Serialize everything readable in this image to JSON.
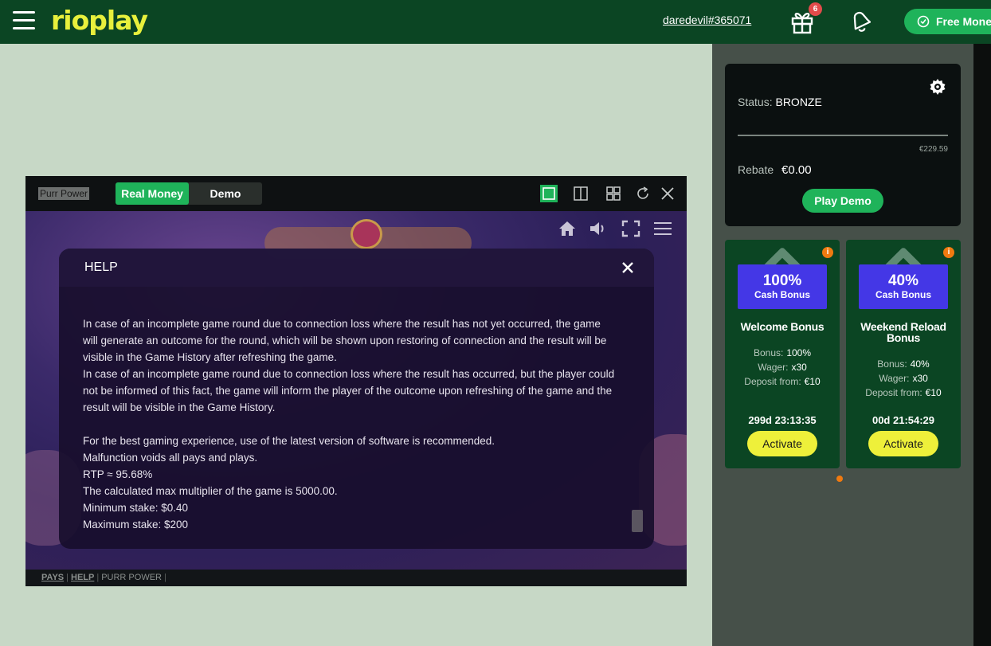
{
  "header": {
    "logo": "rioplay",
    "username": "daredevil#365071",
    "gift_count": "6",
    "free_money_label": "Free Mone"
  },
  "status_card": {
    "status_label": "Status:",
    "status_value": "BRONZE",
    "progress_value": "€229.59",
    "progress_fraction": 0.0,
    "rebate_label": "Rebate",
    "rebate_value": "€0.00",
    "play_demo_label": "Play Demo"
  },
  "bonuses": [
    {
      "percent": "100%",
      "type": "Cash Bonus",
      "name": "Welcome Bonus",
      "bonus_label": "Bonus:",
      "bonus_value": "100%",
      "wager_label": "Wager:",
      "wager_value": "x30",
      "deposit_label": "Deposit from:",
      "deposit_value": "€10",
      "timer": "299d  23:13:35",
      "activate_label": "Activate"
    },
    {
      "percent": "40%",
      "type": "Cash Bonus",
      "name": "Weekend Reload Bonus",
      "bonus_label": "Bonus:",
      "bonus_value": "40%",
      "wager_label": "Wager:",
      "wager_value": "x30",
      "deposit_label": "Deposit from:",
      "deposit_value": "€10",
      "timer": "00d  21:54:29",
      "activate_label": "Activate"
    }
  ],
  "game": {
    "title": "Purr Power",
    "mode_real": "Real Money",
    "mode_demo": "Demo",
    "help": {
      "title": "HELP",
      "paragraphs": [
        "In case of an incomplete game round due to connection loss where the result has not yet occurred, the game will generate an outcome for the round, which will be shown upon restoring of connection and the result will be visible in the Game History after refreshing the game.",
        "In case of an incomplete game round due to connection loss where the result has occurred, but the player could not be informed of this fact, the game will inform the player of the outcome upon refreshing of the game and the result will be visible in the Game History.",
        "For the best gaming experience, use of the latest version of software is recommended.",
        "Malfunction voids all pays and plays.",
        "RTP ≈ 95.68%",
        "The calculated max multiplier of the game is 5000.00.",
        "Minimum stake: $0.40",
        "Maximum stake: $200"
      ]
    },
    "footer": {
      "pays": "PAYS",
      "help": "HELP",
      "purr_power": "PURR POWER"
    }
  },
  "colors": {
    "header_bg": "#0b4523",
    "accent_green": "#1fb35a",
    "logo_yellow": "#e8f03c",
    "bonus_tag": "#4437e6",
    "activate_yellow": "#eef03a",
    "info_orange": "#f07a10"
  },
  "icons": [
    "menu-icon",
    "gift-icon",
    "bell-icon",
    "coin-icon",
    "gear-icon",
    "info-icon",
    "home-icon",
    "speaker-icon",
    "fullscreen-icon",
    "menu-icon",
    "close-icon",
    "single-view-icon",
    "split-view-icon",
    "grid-view-icon",
    "refresh-icon"
  ]
}
